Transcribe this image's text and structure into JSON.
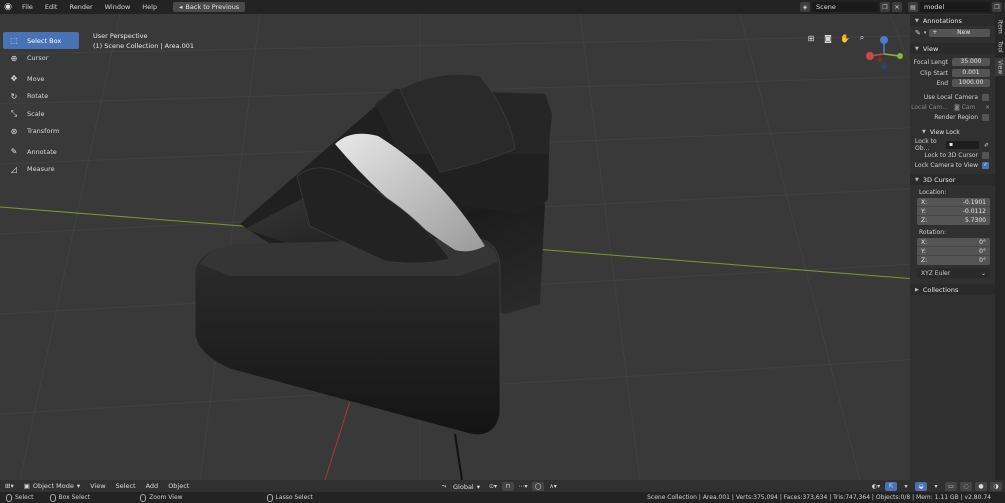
{
  "topbar": {
    "menus": [
      "File",
      "Edit",
      "Render",
      "Window",
      "Help"
    ],
    "back_button": "Back to Previous",
    "scene": "Scene",
    "view_layer": "model"
  },
  "overlay": {
    "line1": "User Perspective",
    "line2": "(1) Scene Collection | Area.001"
  },
  "toolbar": {
    "tools": [
      {
        "label": "Select Box",
        "icon": "select-box-icon",
        "active": true
      },
      {
        "label": "Cursor",
        "icon": "cursor-icon"
      },
      {
        "label": "Move",
        "icon": "move-icon"
      },
      {
        "label": "Rotate",
        "icon": "rotate-icon"
      },
      {
        "label": "Scale",
        "icon": "scale-icon"
      },
      {
        "label": "Transform",
        "icon": "transform-icon"
      },
      {
        "label": "Annotate",
        "icon": "annotate-icon"
      },
      {
        "label": "Measure",
        "icon": "measure-icon"
      }
    ]
  },
  "sidebar": {
    "tabs": [
      "Item",
      "Tool",
      "View"
    ],
    "annotations": {
      "title": "Annotations",
      "new_label": "New"
    },
    "view": {
      "title": "View",
      "focal_label": "Focal Lengt",
      "focal_value": "35.000",
      "clip_start_label": "Clip Start",
      "clip_start_value": "0.001",
      "end_label": "End",
      "end_value": "1000.00",
      "use_local_camera": "Use Local Camera",
      "local_camera_label": "Local Cam...",
      "local_camera_value": "Cam",
      "render_region": "Render Region"
    },
    "view_lock": {
      "title": "View Lock",
      "lock_to_obj": "Lock to Ob...",
      "lock_to_cursor": "Lock to 3D Cursor",
      "lock_camera": "Lock Camera to View"
    },
    "cursor": {
      "title": "3D Cursor",
      "location_label": "Location:",
      "loc": [
        {
          "axis": "X:",
          "value": "-0.1901"
        },
        {
          "axis": "Y:",
          "value": "-0.0112"
        },
        {
          "axis": "Z:",
          "value": "5.7300"
        }
      ],
      "rotation_label": "Rotation:",
      "rot": [
        {
          "axis": "X:",
          "value": "0°"
        },
        {
          "axis": "Y:",
          "value": "0°"
        },
        {
          "axis": "Z:",
          "value": "0°"
        }
      ],
      "rotation_mode": "XYZ Euler"
    },
    "collections": {
      "title": "Collections"
    }
  },
  "header": {
    "mode": "Object Mode",
    "menus": [
      "View",
      "Select",
      "Add",
      "Object"
    ],
    "orientation": "Global"
  },
  "status": {
    "hints": [
      "Select",
      "Box Select",
      "Zoom View",
      "Lasso Select"
    ],
    "stats": "Scene Collection | Area.001 | Verts:375,094 | Faces:373,634 | Tris:747,364 | Objects:0/8 | Mem: 1.11 GB | v2.80.74"
  },
  "colors": {
    "accent": "#4772b3",
    "x_axis": "#a33a3a",
    "y_axis": "#7a9a2a",
    "viewport_bg": "#393939"
  }
}
